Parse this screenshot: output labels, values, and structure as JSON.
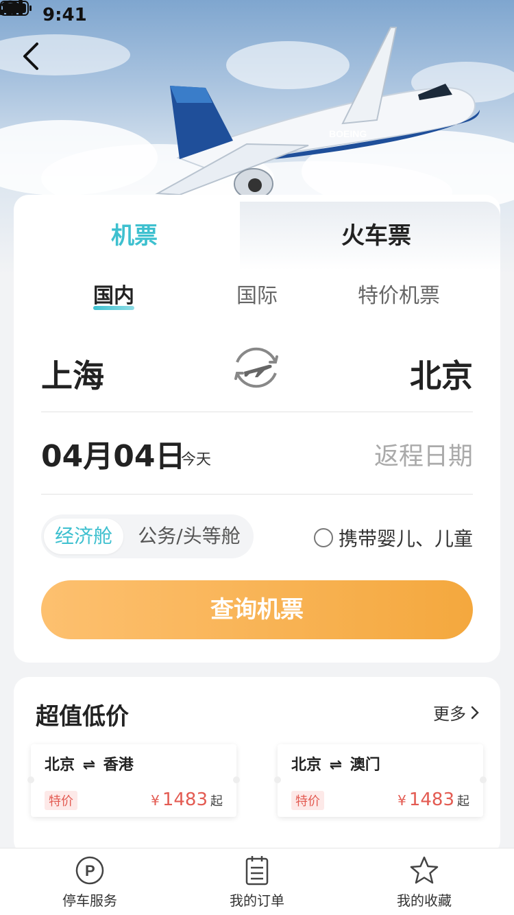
{
  "status_bar": {
    "time": "9:41"
  },
  "tabs": {
    "flight": "机票",
    "train": "火车票"
  },
  "subtabs": [
    "国内",
    "国际",
    "特价机票"
  ],
  "route": {
    "from": "上海",
    "to": "北京"
  },
  "date": {
    "depart": "04月04日",
    "today": "今天",
    "return_placeholder": "返程日期"
  },
  "cabin": {
    "economy": "经济舱",
    "business": "公务/头等舱"
  },
  "kids_label": "携带婴儿、儿童",
  "search_button": "查询机票",
  "deals": {
    "title": "超值低价",
    "more": "更多",
    "items": [
      {
        "from": "北京",
        "to": "香港",
        "tag": "特价",
        "currency": "¥",
        "price": "1483",
        "suffix": "起"
      },
      {
        "from": "北京",
        "to": "澳门",
        "tag": "特价",
        "currency": "¥",
        "price": "1483",
        "suffix": "起"
      }
    ]
  },
  "nav": [
    "停车服务",
    "我的订单",
    "我的收藏"
  ],
  "colors": {
    "accent": "#3ec0cf",
    "button_start": "#fdc06f",
    "button_end": "#f4a83e",
    "price": "#e35b52"
  }
}
